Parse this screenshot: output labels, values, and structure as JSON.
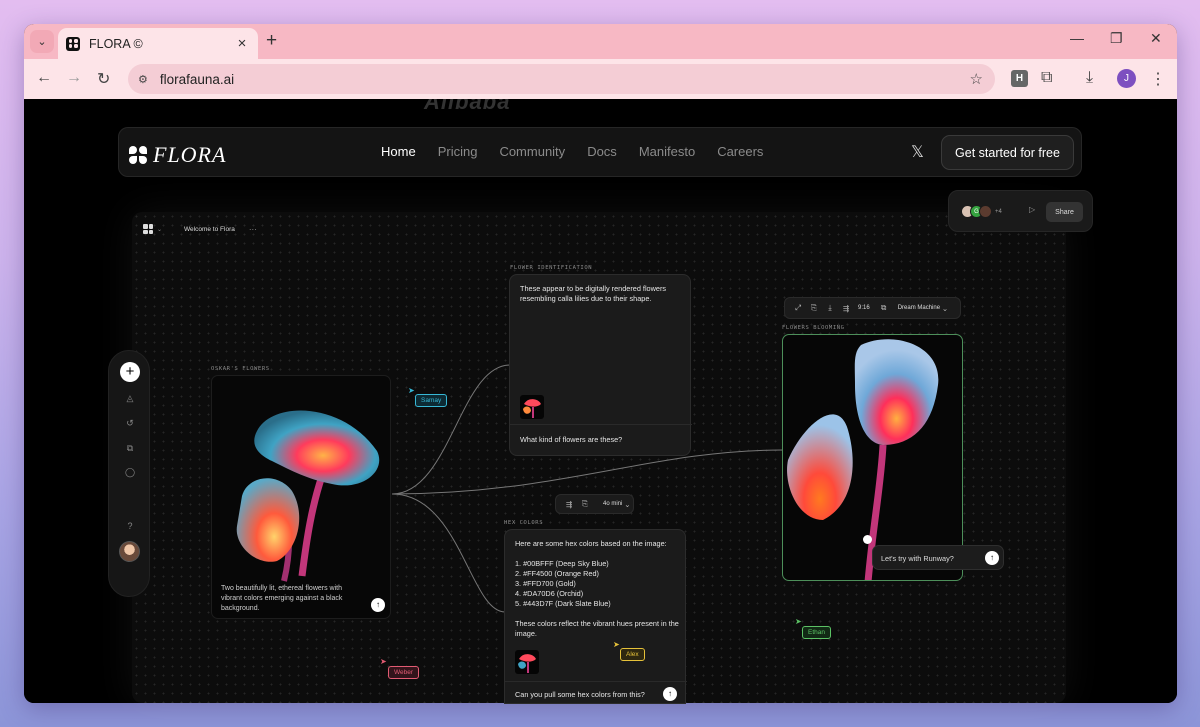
{
  "browser": {
    "tab_title": "FLORA ©",
    "url": "florafauna.ai",
    "profile_initial": "J",
    "extension_label": "H"
  },
  "site": {
    "brand": "FLORA",
    "logo_strip": "Alibaba",
    "nav": [
      {
        "label": "Home",
        "active": true
      },
      {
        "label": "Pricing",
        "active": false
      },
      {
        "label": "Community",
        "active": false
      },
      {
        "label": "Docs",
        "active": false
      },
      {
        "label": "Manifesto",
        "active": false
      },
      {
        "label": "Careers",
        "active": false
      }
    ],
    "cta": "Get started for free"
  },
  "canvas": {
    "title": "Welcome to Flora",
    "menu": "···",
    "share": {
      "label": "Share",
      "avatar_initial": "G",
      "extra_count": "+4"
    },
    "nodes": {
      "oskar": {
        "label": "OSKAR'S FLOWERS",
        "caption": "Two beautifully lit, ethereal flowers with vibrant colors emerging against a black background."
      },
      "identification": {
        "label": "FLOWER IDENTIFICATION",
        "response": "These appear to be digitally rendered flowers resembling calla lilies due to their shape.",
        "prompt": "What kind of flowers are these?"
      },
      "hex": {
        "label": "HEX COLORS",
        "intro": "Here are some hex colors based on the image:",
        "colors": [
          "1. #00BFFF (Deep Sky Blue)",
          "2. #FF4500 (Orange Red)",
          "3. #FFD700 (Gold)",
          "4. #DA70D6 (Orchid)",
          "5. #443D7F (Dark Slate Blue)"
        ],
        "outro": "These colors reflect the vibrant hues present in the image.",
        "prompt": "Can you pull some hex colors from this?",
        "model": "4o mini"
      },
      "blooming": {
        "label": "FLOWERS BLOOMING",
        "ratio": "9:16",
        "model": "Dream Machine",
        "prompt": "Let's try with Runway?"
      }
    },
    "cursors": [
      {
        "name": "Samay",
        "color": "#37b8d6"
      },
      {
        "name": "Weber",
        "color": "#e25b73"
      },
      {
        "name": "Alex",
        "color": "#e6c23a"
      },
      {
        "name": "Ethan",
        "color": "#5cc265"
      }
    ]
  }
}
